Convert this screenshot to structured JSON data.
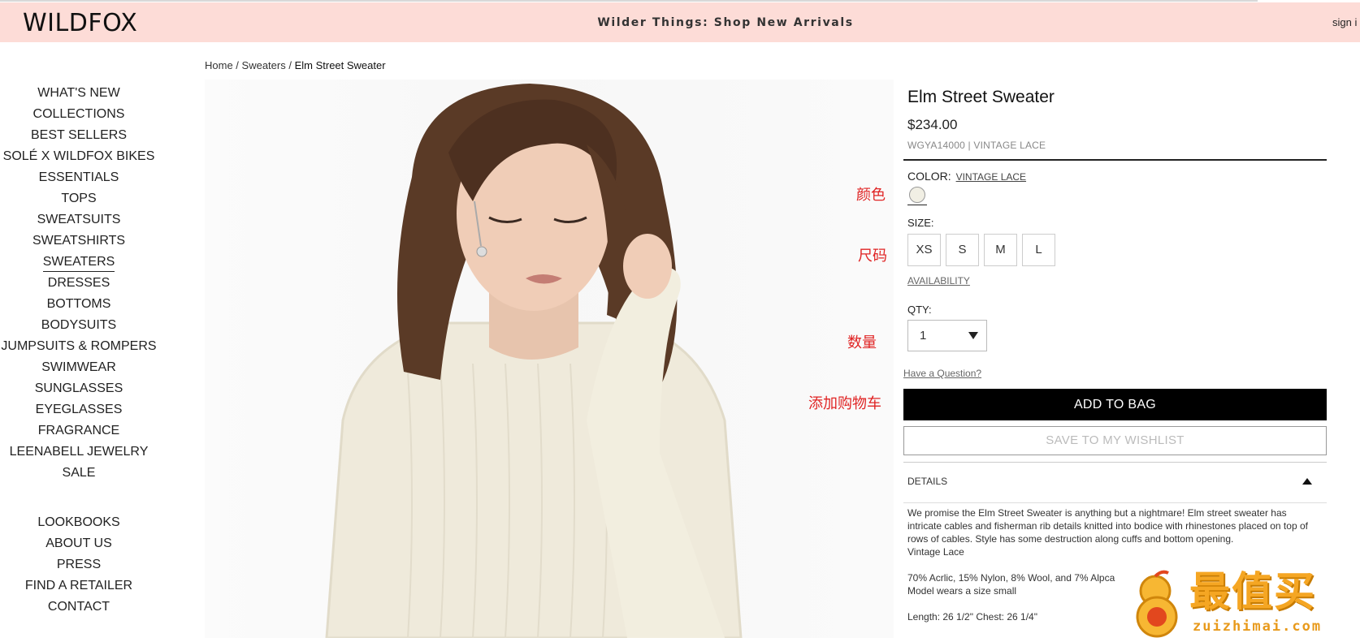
{
  "header": {
    "logo": "WILDFOX",
    "promo": "Wilder Things: Shop New Arrivals",
    "sign_in": "sign i"
  },
  "breadcrumb": {
    "home": "Home",
    "sep1": " / ",
    "category": "Sweaters",
    "sep2": " / ",
    "current": "Elm Street Sweater"
  },
  "nav": {
    "main_items": [
      "WHAT'S NEW",
      "COLLECTIONS",
      "BEST SELLERS",
      "SOLÉ X WILDFOX BIKES",
      "ESSENTIALS",
      "TOPS",
      "SWEATSUITS",
      "SWEATSHIRTS",
      "SWEATERS",
      "DRESSES",
      "BOTTOMS",
      "BODYSUITS",
      "JUMPSUITS & ROMPERS",
      "SWIMWEAR",
      "SUNGLASSES",
      "EYEGLASSES",
      "FRAGRANCE",
      "LEENABELL JEWELRY",
      "SALE"
    ],
    "active": "SWEATERS",
    "secondary_items": [
      "LOOKBOOKS",
      "ABOUT US",
      "PRESS",
      "FIND A RETAILER",
      "CONTACT"
    ]
  },
  "annotations": {
    "color": "颜色",
    "size": "尺码",
    "quantity": "数量",
    "add_to_cart": "添加购物车"
  },
  "product": {
    "title": "Elm Street Sweater",
    "price": "$234.00",
    "sku": "WGYA14000",
    "sku_sep": "|",
    "color_name": "VINTAGE LACE",
    "color_label": "COLOR:",
    "color_value": "VINTAGE LACE",
    "swatch_color": "#f1efe4",
    "size_label": "SIZE:",
    "sizes": [
      "XS",
      "S",
      "M",
      "L"
    ],
    "availability": "AVAILABILITY",
    "qty_label": "QTY:",
    "qty_value": "1",
    "have_question": "Have a Question?",
    "add_to_bag": "ADD TO BAG",
    "save_wishlist": "SAVE TO MY WISHLIST",
    "details_label": "DETAILS",
    "description": "We promise the Elm Street Sweater is anything but a nightmare! Elm street sweater has intricate cables and fisherman rib details knitted into bodice with rhinestones placed on top of rows of cables. Style has some destruction along cuffs and bottom opening.",
    "desc_color": "Vintage Lace",
    "composition": "70% Acrlic, 15% Nylon, 8% Wool, and 7% Alpca",
    "model_size": "Model wears a size small",
    "length": "Length: 26 1/2\" Chest: 26 1/4\""
  },
  "watermark": {
    "brand": "最值买",
    "url": "zuizhimai.com"
  },
  "colors": {
    "header_bg": "#fddcd7",
    "button_black": "#000000",
    "annotation_red": "#e02424",
    "watermark_orange": "#f5a623"
  }
}
